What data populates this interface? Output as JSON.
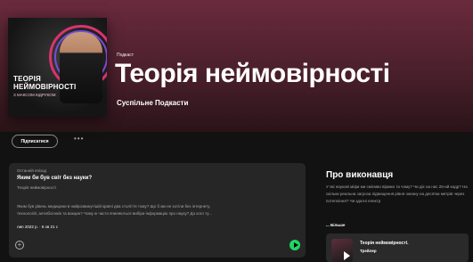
{
  "cover": {
    "title_line1": "ТЕОРІЯ",
    "title_line2": "НЕЙМОВІРНОСТІ",
    "subtitle": "З МАКСОМ КІДРУКОМ"
  },
  "header": {
    "kind": "Подкаст",
    "title": "Теорія неймовірності",
    "publisher": "Суспільне Подкасти"
  },
  "actions": {
    "follow_label": "Підписатися",
    "more_label": "•••"
  },
  "episode": {
    "kicker": "Останній епізод",
    "title": "Яким би був світ без науки?",
    "show": "Теорія неймовірності",
    "description_line1": "Яким був рівень медицини в найрозвинутішій країні два століття тому? Що б ми не хотіли без інтернету,",
    "description_line2": "технологій, антибіотиків та вакцин? Чому ж часто вчиняються вибіри інформацію про науку? До кого ту...",
    "meta": "лип 2022 р. · 6 хв 21 с",
    "add_icon": "+"
  },
  "about": {
    "title": "Про виконавця",
    "text": "У які наукові міфи ми сміливо віримо та чому? Чи діє на нас 25-ий кадр? На скільки реальна загроза підвищення рівня океану на десятки метрів через потепління? Чи здатні електр",
    "more_label": "... Більше"
  },
  "trailer": {
    "title": "Теорія неймовірності.",
    "subtitle": "Трейлер"
  },
  "colors": {
    "header_gradient_top": "#6a2a3d",
    "background": "#121212",
    "card": "#262626",
    "accent": "#1ed760"
  }
}
